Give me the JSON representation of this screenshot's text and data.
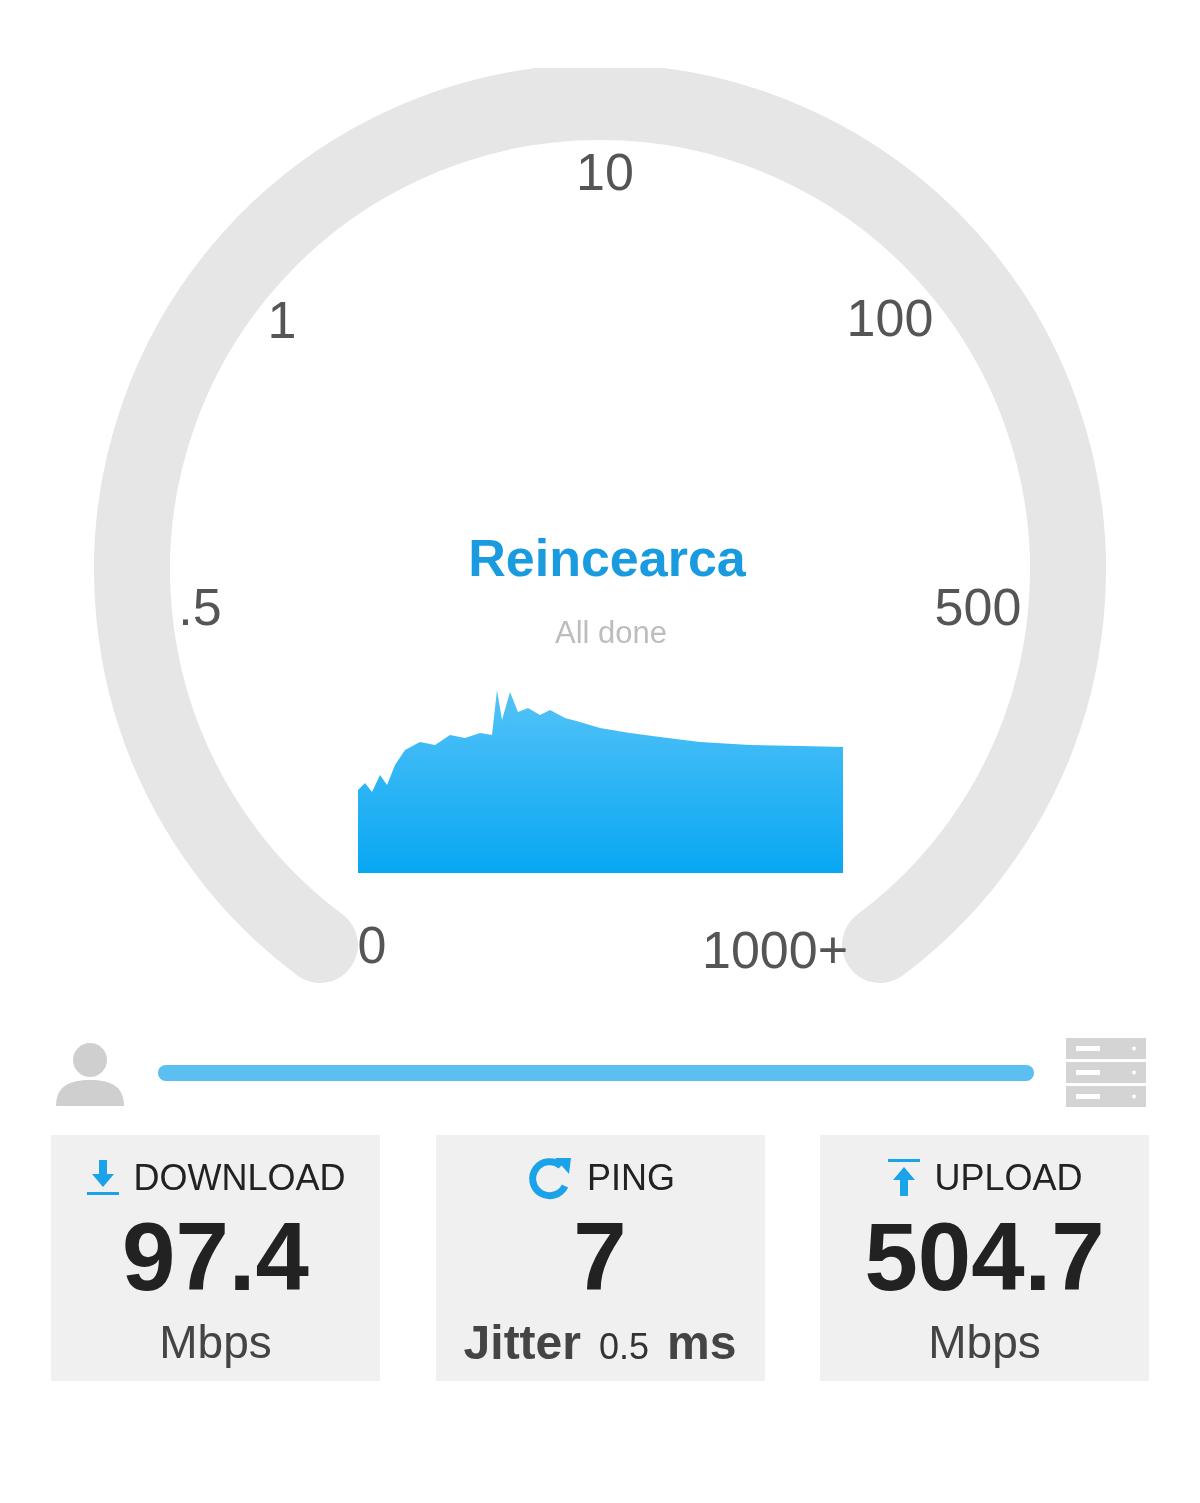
{
  "gauge": {
    "ticks": [
      "0",
      ".5",
      "1",
      "10",
      "100",
      "500",
      "1000+"
    ],
    "action": "Reincearca",
    "status": "All done"
  },
  "progress": {
    "level": 1
  },
  "results": [
    {
      "kind": "download",
      "label": "DOWNLOAD",
      "value": "97.4",
      "unit": "Mbps"
    },
    {
      "kind": "ping",
      "label": "PING",
      "value": "7",
      "jitter_label": "Jitter",
      "jitter_value": "0.5",
      "jitter_unit": "ms"
    },
    {
      "kind": "upload",
      "label": "UPLOAD",
      "value": "504.7",
      "unit": "Mbps"
    }
  ]
}
